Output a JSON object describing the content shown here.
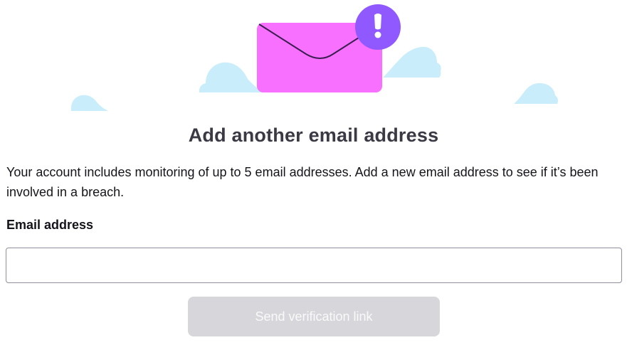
{
  "dialog": {
    "title": "Add another email address",
    "description": "Your account includes monitoring of up to 5 email addresses. Add a new email address to see if it’s been involved in a breach.",
    "field_label": "Email address",
    "input_value": "",
    "input_placeholder": "",
    "submit_label": "Send verification link",
    "submit_enabled": false
  },
  "illustration": {
    "icons": [
      "envelope-icon",
      "alert-badge-icon",
      "cloud-icon"
    ],
    "colors": {
      "envelope": "#f770ff",
      "badge": "#9059ff",
      "cloud": "#c9edfa"
    }
  },
  "colors": {
    "title_text": "#3a3944",
    "body_text": "#15141a",
    "input_border": "#8f8f9d",
    "button_disabled_bg": "#d7d7db",
    "button_disabled_text": "#f9f9fa"
  }
}
